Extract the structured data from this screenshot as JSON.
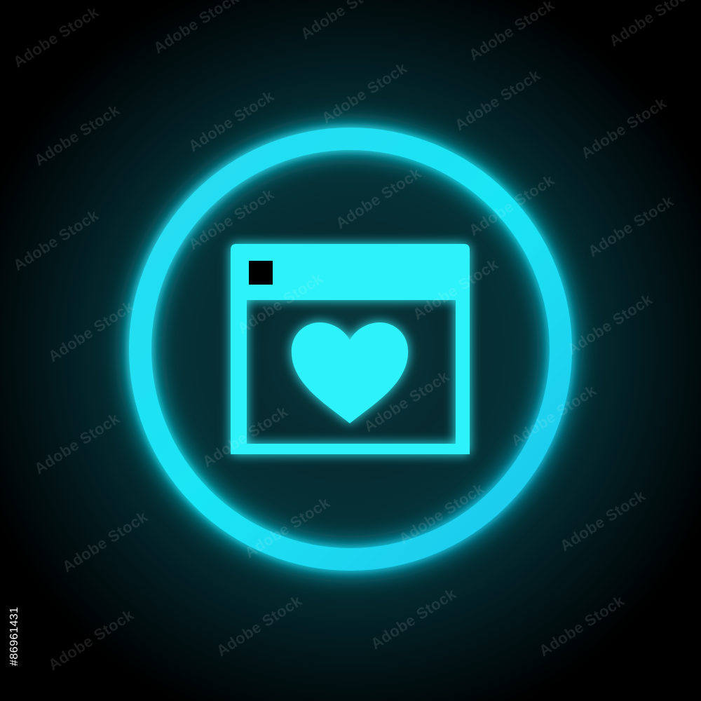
{
  "image": {
    "background_color": "#000000",
    "glow_color": "#1fd8e6",
    "ring_color": "#26e6f2",
    "icon_color": "#2df2fa",
    "icons": [
      "ring-icon",
      "browser-window-icon",
      "heart-icon"
    ]
  },
  "watermark": {
    "text": "Adobe Stock",
    "stock_id": "#86961431"
  }
}
